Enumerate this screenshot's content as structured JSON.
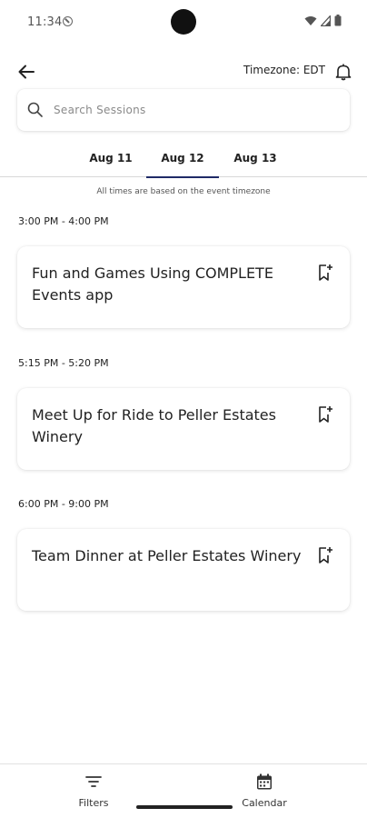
{
  "status_bar": {
    "time": "11:34"
  },
  "header": {
    "timezone_label": "Timezone: EDT"
  },
  "search": {
    "placeholder": "Search Sessions"
  },
  "tabs": [
    {
      "label": "Aug 11",
      "active": false
    },
    {
      "label": "Aug 12",
      "active": true
    },
    {
      "label": "Aug 13",
      "active": false
    }
  ],
  "timezone_note": "All times are based on the event timezone",
  "sessions": [
    {
      "time": "3:00 PM - 4:00 PM",
      "title": "Fun and Games Using COMPLETE Events app"
    },
    {
      "time": "5:15 PM - 5:20 PM",
      "title": "Meet Up for Ride to Peller Estates Winery"
    },
    {
      "time": "6:00 PM - 9:00 PM",
      "title": "Team Dinner at Peller Estates Winery"
    }
  ],
  "bottom_nav": {
    "filters_label": "Filters",
    "calendar_label": "Calendar"
  },
  "colors": {
    "accent": "#1f2a66",
    "text": "#222222",
    "muted": "#8a8a8a"
  },
  "icons": {
    "back": "arrow-left-icon",
    "bell": "bell-icon",
    "search": "search-icon",
    "bookmark": "bookmark-add-icon",
    "filters": "filter-lines-icon",
    "calendar": "calendar-icon"
  }
}
